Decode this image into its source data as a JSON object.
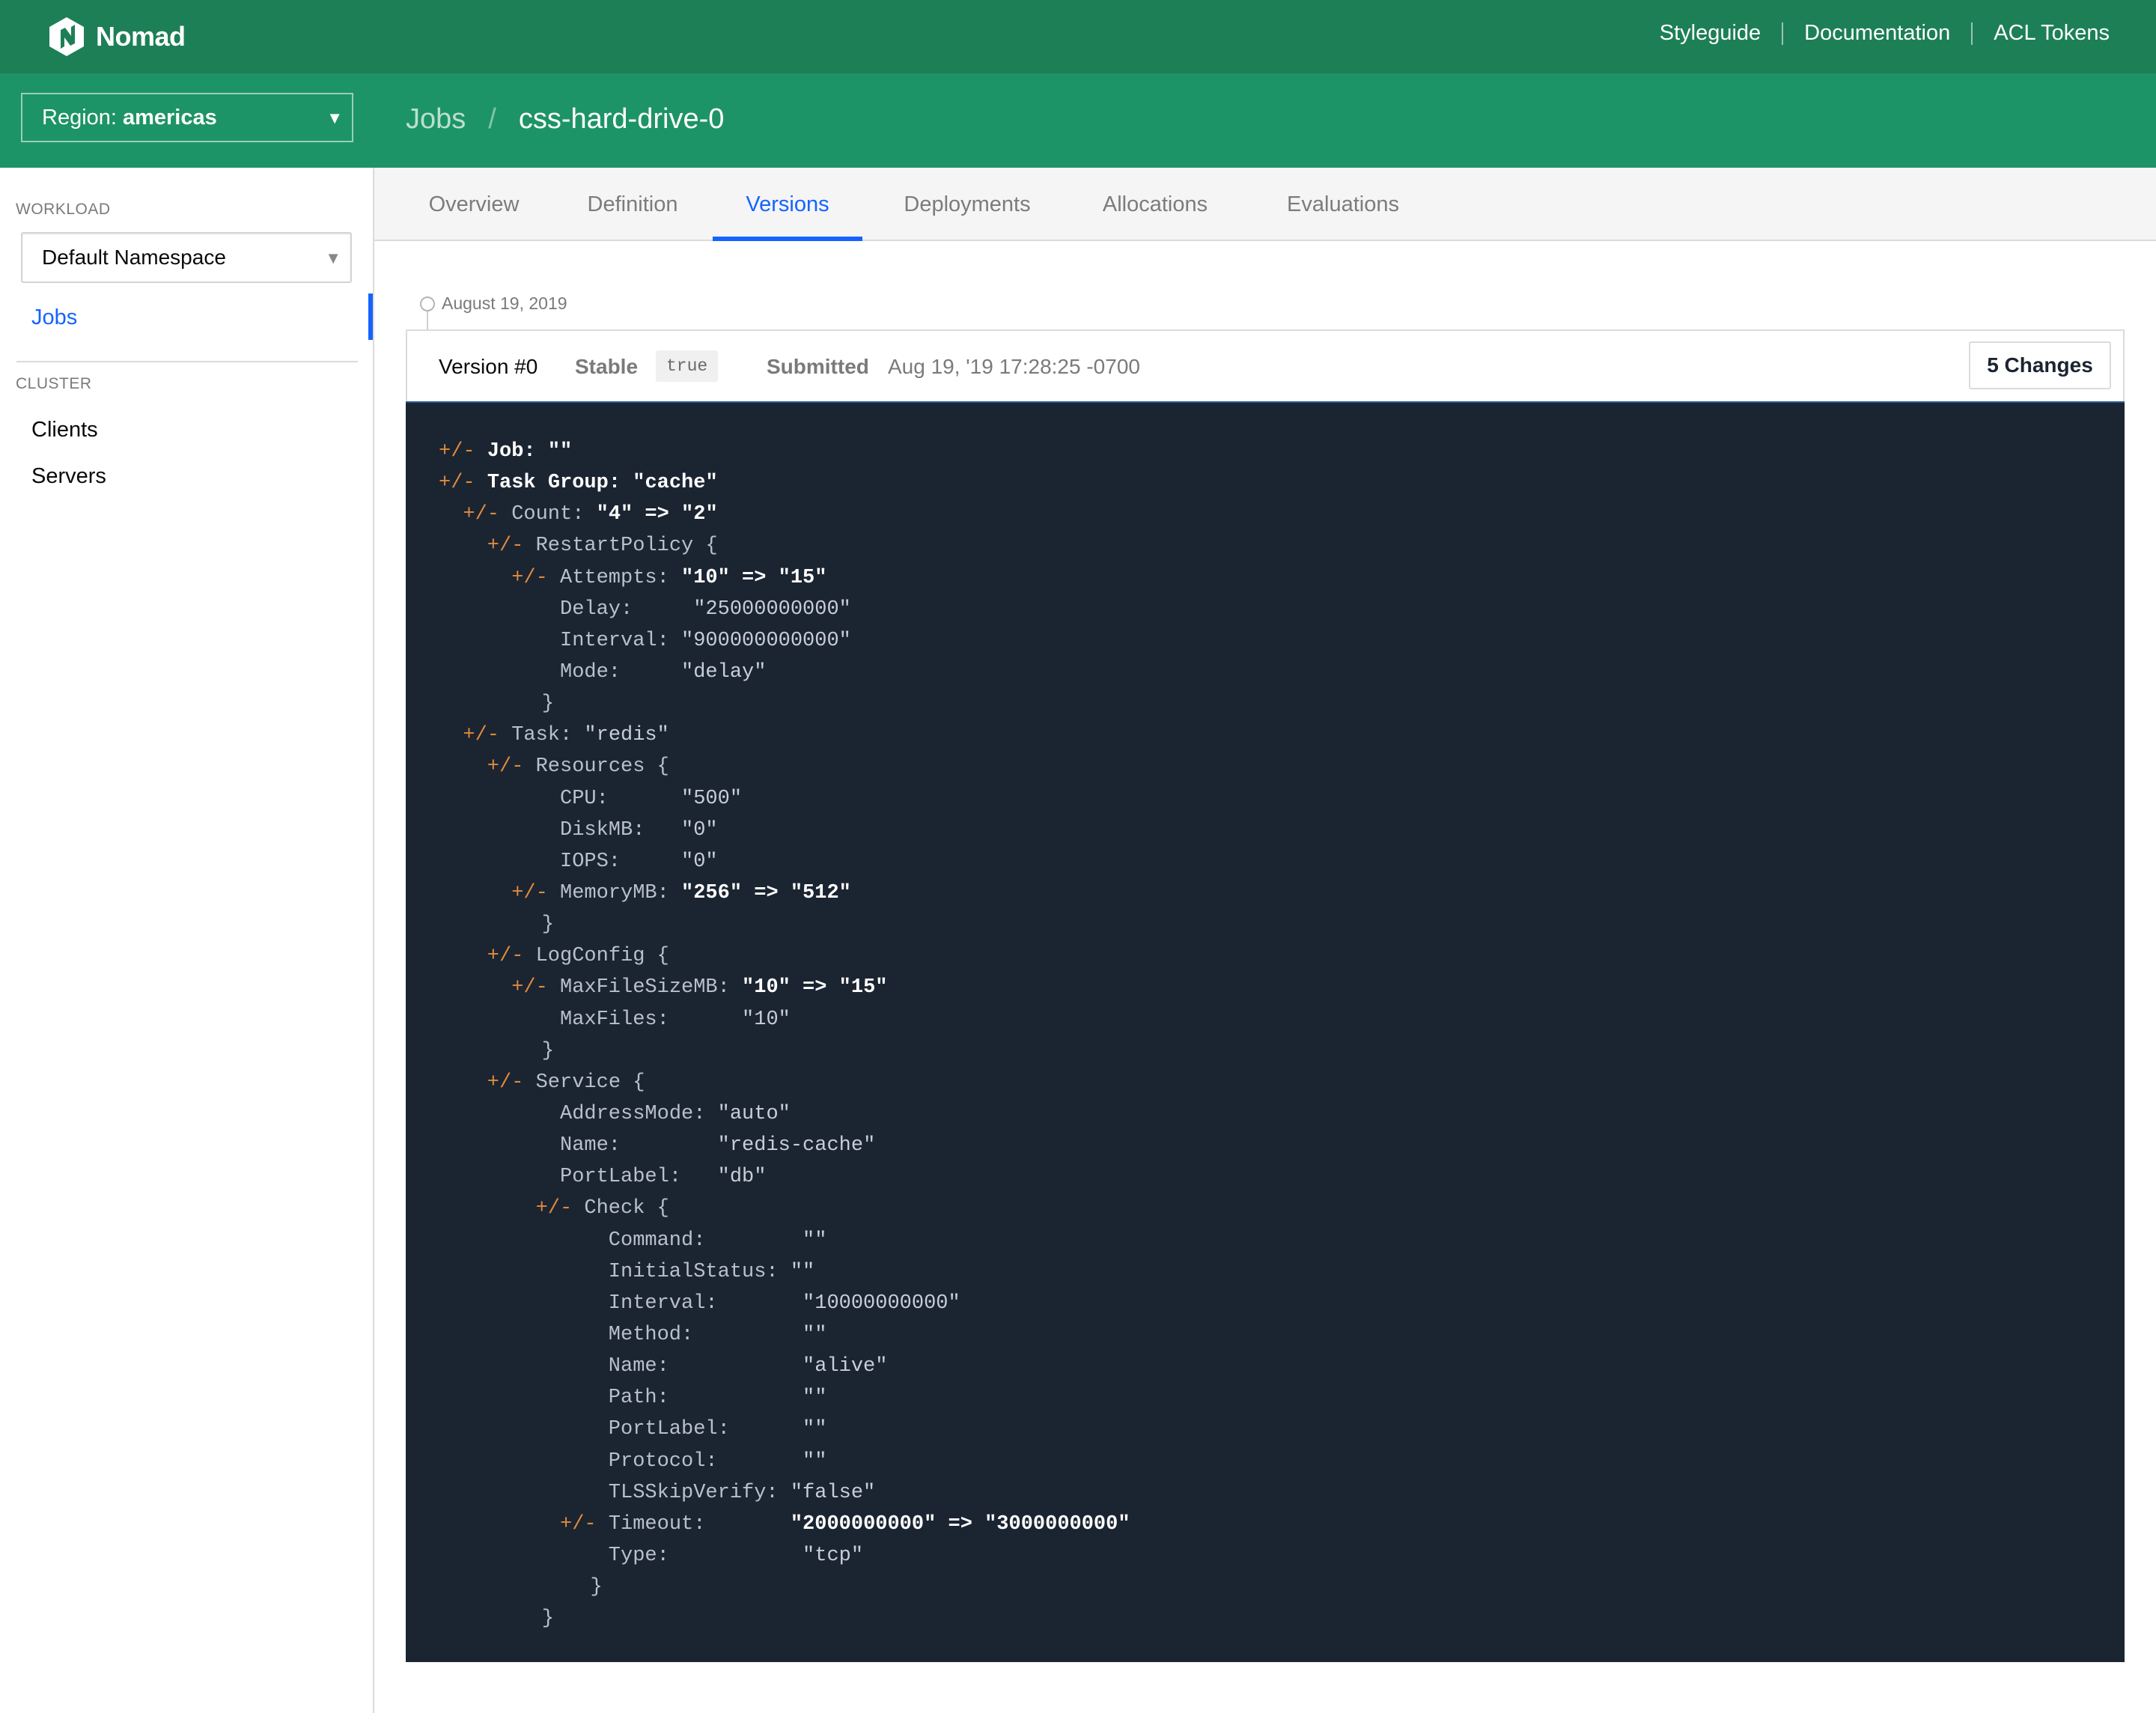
{
  "app": {
    "brand_name": "Nomad",
    "logo_icon": "nomad-logo-icon",
    "colors": {
      "topbar": "#1d7f56",
      "subnav": "#1d9467",
      "accent": "#1563ff",
      "code_bg": "#1b2431",
      "diff_marker": "#e08a3c"
    }
  },
  "topnav": {
    "links": [
      "Styleguide",
      "Documentation",
      "ACL Tokens"
    ]
  },
  "subnav": {
    "region_label": "Region:",
    "region_value": "americas",
    "breadcrumb_root": "Jobs",
    "breadcrumb_separator": "/",
    "breadcrumb_current": "css-hard-drive-0"
  },
  "sidebar": {
    "workload_label": "WORKLOAD",
    "namespace_value": "Default Namespace",
    "jobs_label": "Jobs",
    "cluster_label": "CLUSTER",
    "clients_label": "Clients",
    "servers_label": "Servers"
  },
  "tabs": [
    {
      "label": "Overview",
      "active": false
    },
    {
      "label": "Definition",
      "active": false
    },
    {
      "label": "Versions",
      "active": true
    },
    {
      "label": "Deployments",
      "active": false
    },
    {
      "label": "Allocations",
      "active": false
    },
    {
      "label": "Evaluations",
      "active": false
    }
  ],
  "timeline": {
    "date": "August 19, 2019"
  },
  "version": {
    "number": "Version #0",
    "stable_label": "Stable",
    "stable_value": "true",
    "submitted_label": "Submitted",
    "submitted_value": "Aug 19, '19 17:28:25 -0700",
    "changes_button": "5 Changes"
  },
  "diff": [
    {
      "indent": 0,
      "marker": "+/-",
      "field": "Job:",
      "value": "\"\"",
      "bold": true,
      "keybold": true
    },
    {
      "indent": 0,
      "marker": "+/-",
      "field": "Task Group:",
      "value": "\"cache\"",
      "bold": true,
      "keybold": true
    },
    {
      "indent": 1,
      "marker": "+/-",
      "field": "Count:",
      "value": "\"4\" => \"2\"",
      "bold": true
    },
    {
      "indent": 2,
      "marker": "+/-",
      "field": "RestartPolicy {",
      "value": ""
    },
    {
      "indent": 3,
      "marker": "+/-",
      "field": "Attempts:",
      "value": "\"10\" => \"15\"",
      "bold": true
    },
    {
      "indent": 5,
      "marker": "",
      "field": "Delay:    ",
      "value": "\"25000000000\""
    },
    {
      "indent": 5,
      "marker": "",
      "field": "Interval:",
      "value": "\"900000000000\""
    },
    {
      "indent": 5,
      "marker": "",
      "field": "Mode:    ",
      "value": "\"delay\""
    },
    {
      "indent": 4.25,
      "marker": "",
      "field": "}",
      "value": ""
    },
    {
      "indent": 1,
      "marker": "+/-",
      "field": "Task:",
      "value": "\"redis\""
    },
    {
      "indent": 2,
      "marker": "+/-",
      "field": "Resources {",
      "value": ""
    },
    {
      "indent": 5,
      "marker": "",
      "field": "CPU:     ",
      "value": "\"500\""
    },
    {
      "indent": 5,
      "marker": "",
      "field": "DiskMB:  ",
      "value": "\"0\""
    },
    {
      "indent": 5,
      "marker": "",
      "field": "IOPS:    ",
      "value": "\"0\""
    },
    {
      "indent": 3,
      "marker": "+/-",
      "field": "MemoryMB:",
      "value": "\"256\" => \"512\"",
      "bold": true
    },
    {
      "indent": 4.25,
      "marker": "",
      "field": "}",
      "value": ""
    },
    {
      "indent": 2,
      "marker": "+/-",
      "field": "LogConfig {",
      "value": ""
    },
    {
      "indent": 3,
      "marker": "+/-",
      "field": "MaxFileSizeMB:",
      "value": "\"10\" => \"15\"",
      "bold": true
    },
    {
      "indent": 5,
      "marker": "",
      "field": "MaxFiles:     ",
      "value": "\"10\""
    },
    {
      "indent": 4.25,
      "marker": "",
      "field": "}",
      "value": ""
    },
    {
      "indent": 2,
      "marker": "+/-",
      "field": "Service {",
      "value": ""
    },
    {
      "indent": 5,
      "marker": "",
      "field": "AddressMode:",
      "value": "\"auto\""
    },
    {
      "indent": 5,
      "marker": "",
      "field": "Name:       ",
      "value": "\"redis-cache\""
    },
    {
      "indent": 5,
      "marker": "",
      "field": "PortLabel:  ",
      "value": "\"db\""
    },
    {
      "indent": 4,
      "marker": "+/-",
      "field": "Check {",
      "value": ""
    },
    {
      "indent": 7,
      "marker": "",
      "field": "Command:       ",
      "value": "\"\""
    },
    {
      "indent": 7,
      "marker": "",
      "field": "InitialStatus:",
      "value": "\"\""
    },
    {
      "indent": 7,
      "marker": "",
      "field": "Interval:      ",
      "value": "\"10000000000\""
    },
    {
      "indent": 7,
      "marker": "",
      "field": "Method:        ",
      "value": "\"\""
    },
    {
      "indent": 7,
      "marker": "",
      "field": "Name:          ",
      "value": "\"alive\""
    },
    {
      "indent": 7,
      "marker": "",
      "field": "Path:          ",
      "value": "\"\""
    },
    {
      "indent": 7,
      "marker": "",
      "field": "PortLabel:     ",
      "value": "\"\""
    },
    {
      "indent": 7,
      "marker": "",
      "field": "Protocol:      ",
      "value": "\"\""
    },
    {
      "indent": 7,
      "marker": "",
      "field": "TLSSkipVerify:",
      "value": "\"false\""
    },
    {
      "indent": 5,
      "marker": "+/-",
      "field": "Timeout:      ",
      "value": "\"2000000000\" => \"3000000000\"",
      "bold": true
    },
    {
      "indent": 7,
      "marker": "",
      "field": "Type:          ",
      "value": "\"tcp\""
    },
    {
      "indent": 6.25,
      "marker": "",
      "field": "}",
      "value": ""
    },
    {
      "indent": 4.25,
      "marker": "",
      "field": "}",
      "value": ""
    }
  ]
}
